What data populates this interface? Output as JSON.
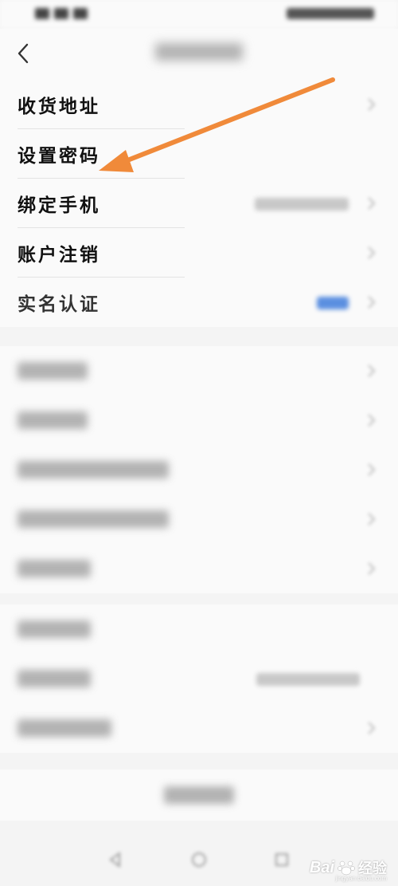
{
  "account_rows": [
    {
      "label": "收货地址"
    },
    {
      "label": "设置密码"
    },
    {
      "label": "绑定手机"
    },
    {
      "label": "账户注销"
    },
    {
      "label": "实名认证"
    }
  ],
  "watermark": {
    "brand": "Bai",
    "brand_tail": "经验",
    "url": "jingyan.baidu.com"
  },
  "colors": {
    "arrow": "#f08a3a",
    "accent_blue": "#5b8fe0"
  },
  "icons": {
    "back": "chevron-left-icon",
    "row_chevron": "chevron-right-icon",
    "baidu_paw": "paw-icon"
  }
}
